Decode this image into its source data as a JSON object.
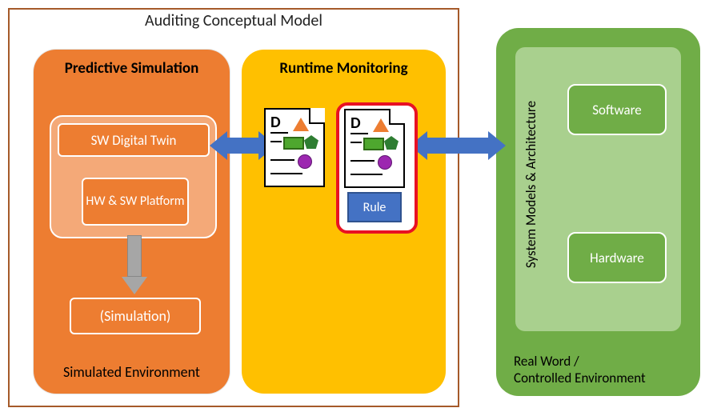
{
  "acm": {
    "title": "Auditing Conceptual Model"
  },
  "predictive": {
    "title": "Predictive Simulation",
    "sw_twin": "SW Digital Twin",
    "hw_sw": "HW & SW Platform",
    "simulation": "(Simulation)",
    "env": "Simulated Environment"
  },
  "runtime": {
    "title": "Runtime Monitoring",
    "rule": "Rule",
    "doc_letter": "D"
  },
  "realworld": {
    "sys_label": "System Models & Architecture",
    "software": "Software",
    "hardware": "Hardware",
    "env_line1": "Real Word /",
    "env_line2": "Controlled Environment"
  },
  "chart_data": {
    "type": "diagram",
    "title": "Auditing Conceptual Model",
    "nodes": [
      {
        "id": "acm",
        "label": "Auditing Conceptual Model",
        "type": "container"
      },
      {
        "id": "pred",
        "label": "Predictive Simulation",
        "parent": "acm",
        "type": "container",
        "color": "#ed7d31"
      },
      {
        "id": "rt",
        "label": "Runtime Monitoring",
        "parent": "acm",
        "type": "container",
        "color": "#ffc000"
      },
      {
        "id": "rw",
        "label": "Real Word / Controlled Environment",
        "type": "container",
        "color": "#70ad47"
      },
      {
        "id": "twin",
        "label": "SW Digital Twin",
        "parent": "pred"
      },
      {
        "id": "hwswplat",
        "label": "HW & SW Platform",
        "parent": "pred"
      },
      {
        "id": "sim",
        "label": "(Simulation)",
        "parent": "pred"
      },
      {
        "id": "simenv",
        "label": "Simulated Environment",
        "parent": "pred",
        "type": "label"
      },
      {
        "id": "doc1",
        "label": "D (document)",
        "parent": "rt",
        "type": "document"
      },
      {
        "id": "doc2",
        "label": "D (document + Rule)",
        "parent": "rt",
        "type": "document",
        "highlight": true
      },
      {
        "id": "rule",
        "label": "Rule",
        "parent": "doc2"
      },
      {
        "id": "sysma",
        "label": "System Models & Architecture",
        "parent": "rw",
        "type": "container"
      },
      {
        "id": "sw",
        "label": "Software",
        "parent": "sysma"
      },
      {
        "id": "hw",
        "label": "Hardware",
        "parent": "sysma"
      }
    ],
    "edges": [
      {
        "from": "hwswplat",
        "to": "sim",
        "type": "arrow",
        "color": "#a6a6a6"
      },
      {
        "from": "rt",
        "to": "pred",
        "type": "biarrow",
        "color": "#4472c4"
      },
      {
        "from": "rt",
        "to": "rw",
        "type": "biarrow",
        "color": "#4472c4"
      }
    ]
  }
}
